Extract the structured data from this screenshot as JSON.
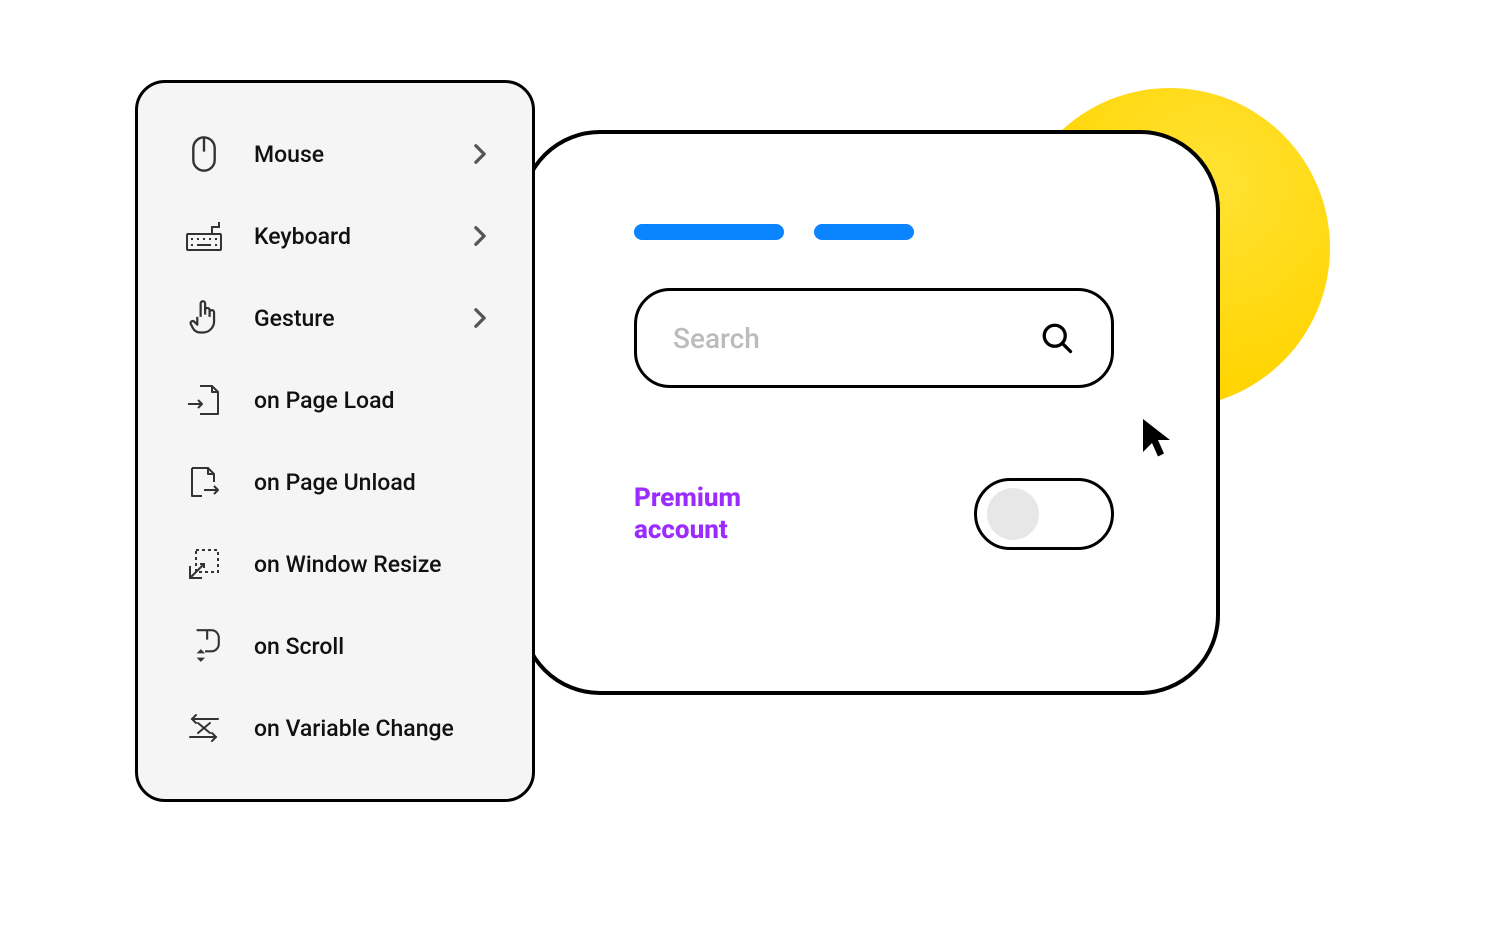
{
  "menu": {
    "items": [
      {
        "label": "Mouse",
        "icon": "mouse-icon",
        "has_submenu": true
      },
      {
        "label": "Keyboard",
        "icon": "keyboard-icon",
        "has_submenu": true
      },
      {
        "label": "Gesture",
        "icon": "gesture-icon",
        "has_submenu": true
      },
      {
        "label": "on Page Load",
        "icon": "page-load-icon",
        "has_submenu": false
      },
      {
        "label": "on Page Unload",
        "icon": "page-unload-icon",
        "has_submenu": false
      },
      {
        "label": "on Window Resize",
        "icon": "window-resize-icon",
        "has_submenu": false
      },
      {
        "label": "on Scroll",
        "icon": "scroll-icon",
        "has_submenu": false
      },
      {
        "label": "on Variable Change",
        "icon": "variable-change-icon",
        "has_submenu": false
      }
    ]
  },
  "panel": {
    "search_placeholder": "Search",
    "premium_line1": "Premium",
    "premium_line2": "account",
    "toggle_on": false
  },
  "colors": {
    "accent_blue": "#0a84ff",
    "accent_purple": "#9b2cff",
    "accent_yellow": "#ffd400"
  }
}
